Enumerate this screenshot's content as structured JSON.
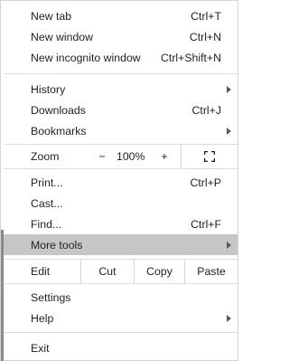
{
  "menu": {
    "new_tab": {
      "label": "New tab",
      "shortcut": "Ctrl+T"
    },
    "new_window": {
      "label": "New window",
      "shortcut": "Ctrl+N"
    },
    "new_incognito": {
      "label": "New incognito window",
      "shortcut": "Ctrl+Shift+N"
    },
    "history": {
      "label": "History"
    },
    "downloads": {
      "label": "Downloads",
      "shortcut": "Ctrl+J"
    },
    "bookmarks": {
      "label": "Bookmarks"
    },
    "zoom": {
      "label": "Zoom",
      "minus": "−",
      "value": "100%",
      "plus": "+"
    },
    "print": {
      "label": "Print...",
      "shortcut": "Ctrl+P"
    },
    "cast": {
      "label": "Cast..."
    },
    "find": {
      "label": "Find...",
      "shortcut": "Ctrl+F"
    },
    "more_tools": {
      "label": "More tools"
    },
    "edit": {
      "label": "Edit",
      "cut": "Cut",
      "copy": "Copy",
      "paste": "Paste"
    },
    "settings": {
      "label": "Settings"
    },
    "help": {
      "label": "Help"
    },
    "exit": {
      "label": "Exit"
    }
  },
  "icons": {
    "submenu": "chevron-right-icon",
    "fullscreen": "fullscreen-icon"
  },
  "colors": {
    "highlight": "#c6c6c6",
    "separator": "#dcdcdc",
    "text": "#1f1f1f"
  }
}
